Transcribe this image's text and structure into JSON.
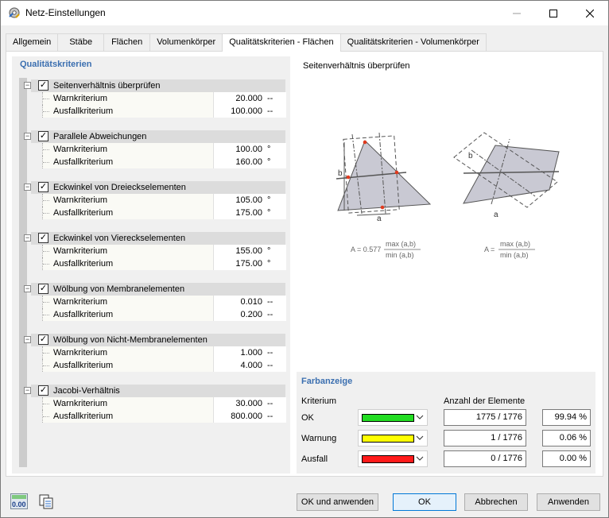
{
  "window": {
    "title": "Netz-Einstellungen"
  },
  "tabs": [
    {
      "label": "Allgemein"
    },
    {
      "label": "Stäbe"
    },
    {
      "label": "Flächen"
    },
    {
      "label": "Volumenkörper"
    },
    {
      "label": "Qualitätskriterien - Flächen",
      "active": true
    },
    {
      "label": "Qualitätskriterien - Volumenkörper"
    }
  ],
  "left": {
    "title": "Qualitätskriterien",
    "criteria": [
      {
        "label": "Seitenverhältnis überprüfen",
        "checked": true,
        "rows": [
          {
            "label": "Warnkriterium",
            "value": "20.000",
            "unit": "--"
          },
          {
            "label": "Ausfallkriterium",
            "value": "100.000",
            "unit": "--"
          }
        ]
      },
      {
        "label": "Parallele Abweichungen",
        "checked": true,
        "rows": [
          {
            "label": "Warnkriterium",
            "value": "100.00",
            "unit": "°"
          },
          {
            "label": "Ausfallkriterium",
            "value": "160.00",
            "unit": "°"
          }
        ]
      },
      {
        "label": "Eckwinkel von Dreieckselementen",
        "checked": true,
        "rows": [
          {
            "label": "Warnkriterium",
            "value": "105.00",
            "unit": "°"
          },
          {
            "label": "Ausfallkriterium",
            "value": "175.00",
            "unit": "°"
          }
        ]
      },
      {
        "label": "Eckwinkel von Viereckselementen",
        "checked": true,
        "rows": [
          {
            "label": "Warnkriterium",
            "value": "155.00",
            "unit": "°"
          },
          {
            "label": "Ausfallkriterium",
            "value": "175.00",
            "unit": "°"
          }
        ]
      },
      {
        "label": "Wölbung von Membranelementen",
        "checked": true,
        "rows": [
          {
            "label": "Warnkriterium",
            "value": "0.010",
            "unit": "--"
          },
          {
            "label": "Ausfallkriterium",
            "value": "0.200",
            "unit": "--"
          }
        ]
      },
      {
        "label": "Wölbung von Nicht-Membranelementen",
        "checked": true,
        "rows": [
          {
            "label": "Warnkriterium",
            "value": "1.000",
            "unit": "--"
          },
          {
            "label": "Ausfallkriterium",
            "value": "4.000",
            "unit": "--"
          }
        ]
      },
      {
        "label": "Jacobi-Verhältnis",
        "checked": true,
        "rows": [
          {
            "label": "Warnkriterium",
            "value": "30.000",
            "unit": "--"
          },
          {
            "label": "Ausfallkriterium",
            "value": "800.000",
            "unit": "--"
          }
        ]
      }
    ]
  },
  "diagram": {
    "title": "Seitenverhältnis überprüfen",
    "formula_left": {
      "prefix": "A = 0.577",
      "num": "max (a,b)",
      "den": "min (a,b)"
    },
    "formula_right": {
      "prefix": "A =",
      "num": "max (a,b)",
      "den": "min (a,b)"
    },
    "label_a": "a",
    "label_b": "b"
  },
  "colors": {
    "title": "Farbanzeige",
    "col_criterion": "Kriterium",
    "col_count": "Anzahl der Elemente",
    "rows": [
      {
        "name": "OK",
        "color": "#22dd22",
        "count": "1775 / 1776",
        "pct": "99.94 %"
      },
      {
        "name": "Warnung",
        "color": "#ffff00",
        "count": "1 / 1776",
        "pct": "0.06 %"
      },
      {
        "name": "Ausfall",
        "color": "#ff1a1a",
        "count": "0 / 1776",
        "pct": "0.00 %"
      }
    ]
  },
  "buttons": {
    "ok_apply": "OK und anwenden",
    "ok": "OK",
    "cancel": "Abbrechen",
    "apply": "Anwenden"
  },
  "icons": {
    "decimal_icon_text": "0.00"
  }
}
